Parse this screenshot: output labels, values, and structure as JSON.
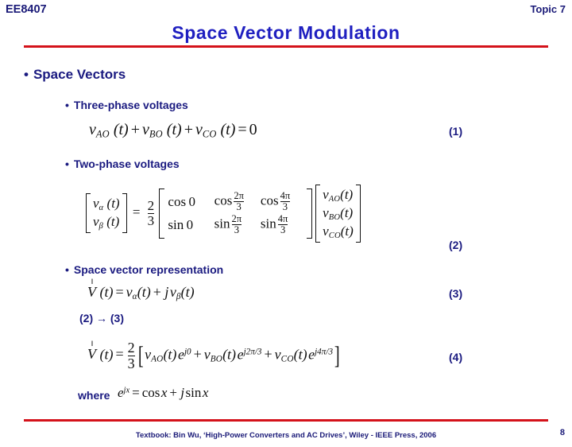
{
  "header": {
    "course_code": "EE8407",
    "topic": "Topic 7",
    "title": "Space Vector Modulation"
  },
  "colors": {
    "title_blue": "#1f1fc0",
    "navy": "#1a1a80",
    "rule_red": "#d4121a",
    "math_black": "#111111"
  },
  "body": {
    "bullet_glyph": "•",
    "level1": "Space Vectors",
    "sections": [
      {
        "label": "Three-phase voltages",
        "eq_number": "(1)"
      },
      {
        "label": "Two-phase voltages",
        "eq_number": "(2)"
      },
      {
        "label": "Space vector representation",
        "eq_number": "(3)"
      }
    ],
    "derivation_note": "(2) → (3)",
    "eq4_number": "(4)",
    "where_label": "where"
  },
  "equations": {
    "eq1": {
      "terms": [
        "v",
        "AO",
        "(t)",
        "+",
        "v",
        "BO",
        "(t)",
        "+",
        "v",
        "CO",
        "(t)",
        "=",
        "0"
      ],
      "plain": "v_AO(t) + v_BO(t) + v_CO(t) = 0"
    },
    "eq2": {
      "lhs": [
        "v",
        "α",
        "(t)",
        "v",
        "β",
        "(t)"
      ],
      "equals": "=",
      "scalar_num": "2",
      "scalar_den": "3",
      "matrix_row1": [
        "cos 0",
        "cos",
        "2π",
        "3",
        "cos",
        "4π",
        "3"
      ],
      "matrix_row2": [
        "sin 0",
        "sin",
        "2π",
        "3",
        "sin",
        "4π",
        "3"
      ],
      "rhs": [
        "v",
        "AO",
        "(t)",
        "v",
        "BO",
        "(t)",
        "v",
        "CO",
        "(t)"
      ],
      "plain": "[v_alpha(t); v_beta(t)] = (2/3)[cos0 cos(2pi/3) cos(4pi/3); sin0 sin(2pi/3) sin(4pi/3)][v_AO(t); v_BO(t); v_CO(t)]"
    },
    "eq3": {
      "lhs_symbol": "V",
      "accent": "‖",
      "terms": [
        "(t)",
        "=",
        "v",
        "α",
        "(t)",
        "+",
        "j",
        "v",
        "β",
        "(t)"
      ],
      "plain": "V(t) = v_alpha(t) + j v_beta(t)"
    },
    "eq4": {
      "lhs_symbol": "V",
      "accent": "‖",
      "scalar_num": "2",
      "scalar_den": "3",
      "terms": [
        "v",
        "AO",
        "(t)",
        "e",
        "j0",
        "+",
        "v",
        "BO",
        "(t)",
        "e",
        "j2π/3",
        "+",
        "v",
        "CO",
        "(t)",
        "e",
        "j4π/3"
      ],
      "plain": "V(t) = (2/3)[v_AO(t)e^{j0} + v_BO(t)e^{j2pi/3} + v_CO(t)e^{j4pi/3}]"
    },
    "eq5": {
      "terms": [
        "e",
        "jx",
        "=",
        "cos",
        "x",
        "+",
        "j",
        "sin",
        "x"
      ],
      "plain": "e^{jx} = cos x + j sin x"
    }
  },
  "footer": {
    "citation": "Textbook: Bin Wu, ‘High-Power Converters and AC Drives’, Wiley - IEEE Press, 2006",
    "page_number": "8"
  }
}
